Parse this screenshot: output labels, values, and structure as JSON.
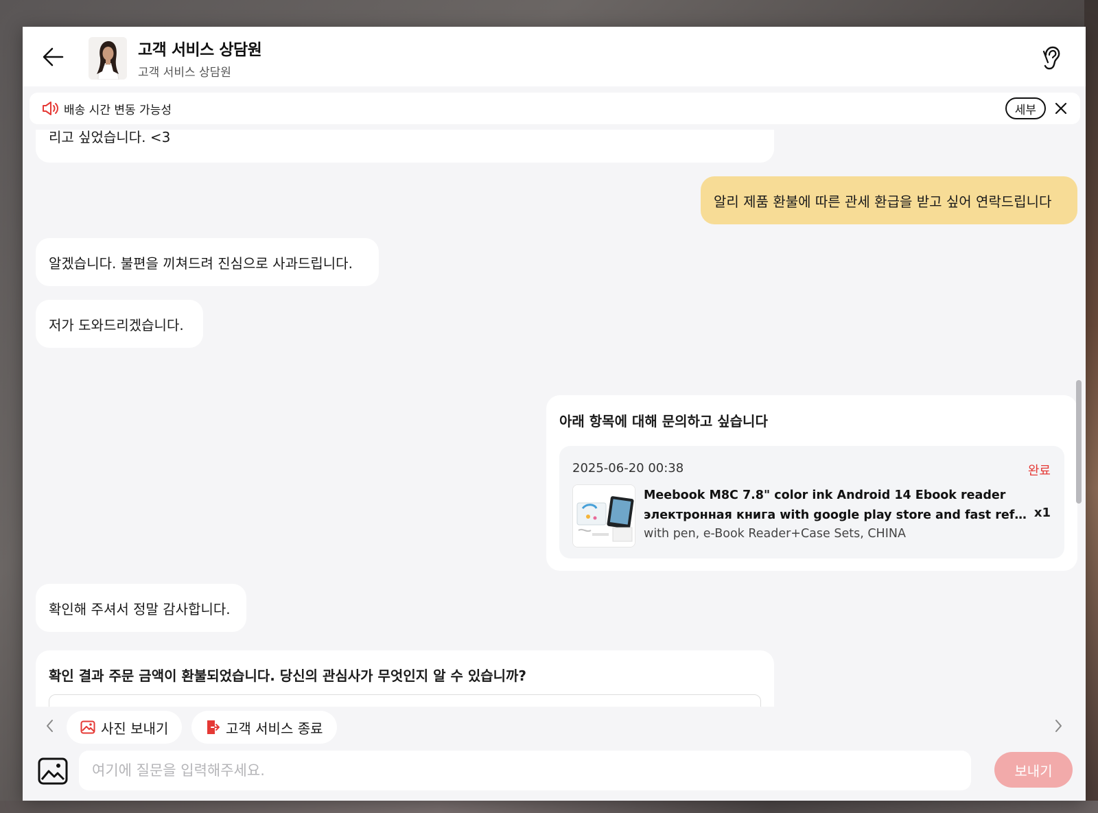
{
  "header": {
    "agent_name": "고객 서비스 상담원",
    "agent_subtitle": "고객 서비스 상담원"
  },
  "notice": {
    "text": "배송 시간 변동 가능성",
    "detail_label": "세부"
  },
  "messages": [
    {
      "from": "agent",
      "text": "리고 싶었습니다. <3"
    },
    {
      "from": "user",
      "text": "알리 제품 환불에 따른 관세 환급을 받고 싶어 연락드립니다"
    },
    {
      "from": "agent",
      "text": "알겠습니다. 불편을 끼쳐드려 진심으로 사과드립니다."
    },
    {
      "from": "agent",
      "text": "저가 도와드리겠습니다."
    },
    {
      "from": "agent",
      "text": "확인해 주셔서 정말 감사합니다."
    }
  ],
  "inquiry_card": {
    "title": "아래 항목에 대해 문의하고 싶습니다",
    "order_datetime": "2025-06-20 00:38",
    "status": "완료",
    "product_title_line1": "Meebook M8C 7.8\" color ink Android 14 Ebook reader",
    "product_title_line2": "электронная книга with google play store and fast refresh 4G...",
    "quantity": "x1",
    "variant": "with pen, e-Book Reader+Case Sets, CHINA"
  },
  "bot_card": {
    "title": "확인 결과 주문 금액이 환불되었습니다. 당신의 관심사가 무엇인지 알 수 있습니까?"
  },
  "quick_actions": [
    {
      "label": "사진 보내기",
      "icon": "image-icon"
    },
    {
      "label": "고객 서비스 종료",
      "icon": "exit-icon"
    }
  ],
  "composer": {
    "placeholder": "여기에 질문을 입력해주세요.",
    "send_label": "보내기"
  },
  "colors": {
    "user_bubble": "#f7dc96",
    "status_complete": "#e53935",
    "send_button": "#f2aaaa",
    "notice_icon": "#e53935"
  }
}
